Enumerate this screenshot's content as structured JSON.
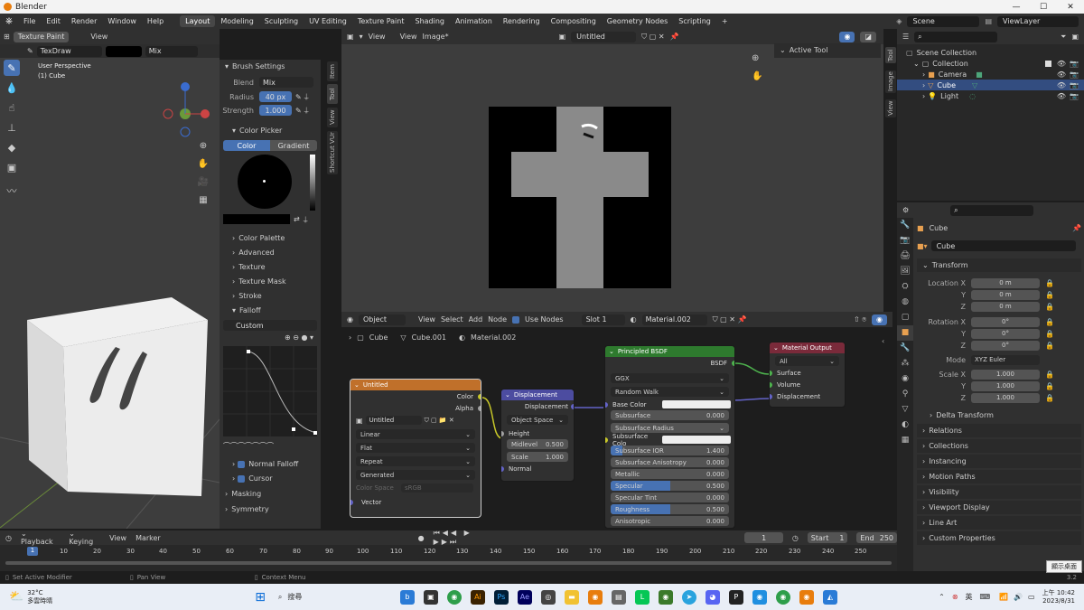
{
  "titlebar": {
    "title": "Blender",
    "min": "—",
    "max": "☐",
    "close": "✕"
  },
  "menu": {
    "items": [
      "File",
      "Edit",
      "Render",
      "Window",
      "Help"
    ],
    "workspaces": [
      "Layout",
      "Modeling",
      "Sculpting",
      "UV Editing",
      "Texture Paint",
      "Shading",
      "Animation",
      "Rendering",
      "Compositing",
      "Geometry Nodes",
      "Scripting"
    ],
    "add": "+",
    "scene_label": "Scene",
    "viewlayer_label": "ViewLayer"
  },
  "viewport": {
    "mode": "Texture Paint",
    "view": "View",
    "brush": "TexDraw",
    "blend_mode": "Mix",
    "radius_label": "Radius",
    "radius_value": "40 px",
    "strength_label": "Strength",
    "perspective": "User Perspective",
    "object": "(1) Cube"
  },
  "tool_settings": {
    "brush_settings": "Brush Settings",
    "blend_label": "Blend",
    "blend_value": "Mix",
    "radius_label": "Radius",
    "radius_value": "40 px",
    "strength_label": "Strength",
    "strength_value": "1.000",
    "color_picker": "Color Picker",
    "color_tab": "Color",
    "gradient_tab": "Gradient",
    "sections": [
      "Color Palette",
      "Advanced",
      "Texture",
      "Texture Mask",
      "Stroke",
      "Falloff"
    ],
    "falloff_preset": "Custom",
    "normal_falloff": "Normal Falloff",
    "cursor": "Cursor",
    "masking": "Masking",
    "symmetry": "Symmetry",
    "side_tabs": [
      "Item",
      "Tool",
      "View",
      "Shortcut VUr"
    ]
  },
  "image_editor": {
    "view": "View",
    "view2": "View",
    "image_menu": "Image*",
    "image_name": "Untitled",
    "active_tool": "Active Tool",
    "side_tabs": [
      "Tool",
      "Image",
      "View"
    ]
  },
  "node_editor": {
    "type": "Object",
    "menus": [
      "View",
      "Select",
      "Add",
      "Node"
    ],
    "use_nodes": "Use Nodes",
    "slot": "Slot 1",
    "material": "Material.002",
    "breadcrumb": [
      "Cube",
      "Cube.001",
      "Material.002"
    ],
    "image_node": {
      "title": "Untitled",
      "out_color": "Color",
      "out_alpha": "Alpha",
      "image": "Untitled",
      "interp": "Linear",
      "proj": "Flat",
      "ext": "Repeat",
      "src": "Generated",
      "cs_label": "Color Space",
      "cs_value": "sRGB",
      "vector": "Vector"
    },
    "disp_node": {
      "title": "Displacement",
      "out": "Displacement",
      "space": "Object Space",
      "height": "Height",
      "midlevel_label": "Midlevel",
      "midlevel": "0.500",
      "scale_label": "Scale",
      "scale": "1.000",
      "normal": "Normal"
    },
    "bsdf_node": {
      "title": "Principled BSDF",
      "out": "BSDF",
      "dist": "GGX",
      "sss_method": "Random Walk",
      "base_color": "Base Color",
      "subsurface": "Subsurface",
      "subsurface_v": "0.000",
      "sss_radius": "Subsurface Radius",
      "sss_color": "Subsurface Colo",
      "sss_ior": "Subsurface IOR",
      "sss_ior_v": "1.400",
      "sss_aniso": "Subsurface Anisotropy",
      "sss_aniso_v": "0.000",
      "metallic": "Metallic",
      "metallic_v": "0.000",
      "specular": "Specular",
      "specular_v": "0.500",
      "spec_tint": "Specular Tint",
      "spec_tint_v": "0.000",
      "roughness": "Roughness",
      "roughness_v": "0.500",
      "anisotropic": "Anisotropic",
      "anisotropic_v": "0.000"
    },
    "out_node": {
      "title": "Material Output",
      "target": "All",
      "surface": "Surface",
      "volume": "Volume",
      "displacement": "Displacement"
    }
  },
  "outliner": {
    "root": "Scene Collection",
    "collection": "Collection",
    "items": [
      "Camera",
      "Cube",
      "Light"
    ]
  },
  "properties": {
    "object_name": "Cube",
    "data_name": "Cube",
    "transform": "Transform",
    "location": {
      "label": "Location X",
      "y": "Y",
      "z": "Z",
      "x_v": "0 m",
      "y_v": "0 m",
      "z_v": "0 m"
    },
    "rotation": {
      "label": "Rotation X",
      "y": "Y",
      "z": "Z",
      "x_v": "0°",
      "y_v": "0°",
      "z_v": "0°"
    },
    "mode_label": "Mode",
    "mode_value": "XYZ Euler",
    "scale": {
      "label": "Scale X",
      "y": "Y",
      "z": "Z",
      "x_v": "1.000",
      "y_v": "1.000",
      "z_v": "1.000"
    },
    "sections": [
      "Delta Transform",
      "Relations",
      "Collections",
      "Instancing",
      "Motion Paths",
      "Visibility",
      "Viewport Display",
      "Line Art",
      "Custom Properties"
    ]
  },
  "timeline": {
    "playback": "Playback",
    "keying": "Keying",
    "view": "View",
    "marker": "Marker",
    "current": "1",
    "start_label": "Start",
    "start": "1",
    "end_label": "End",
    "end": "250",
    "ticks": [
      "0",
      "10",
      "20",
      "30",
      "40",
      "50",
      "60",
      "70",
      "80",
      "90",
      "100",
      "110",
      "120",
      "130",
      "140",
      "150",
      "160",
      "170",
      "180",
      "190",
      "200",
      "210",
      "220",
      "230",
      "240",
      "250"
    ],
    "frame": "1"
  },
  "statusbar": {
    "a": "Set Active Modifier",
    "b": "Pan View",
    "c": "Context Menu",
    "version": "3.2",
    "tooltip": "顯示桌面"
  },
  "taskbar": {
    "weather_temp": "32°C",
    "weather_desc": "多雲時晴",
    "search": "搜尋",
    "lang": "英",
    "time": "上午 10:42",
    "date": "2023/8/31"
  }
}
